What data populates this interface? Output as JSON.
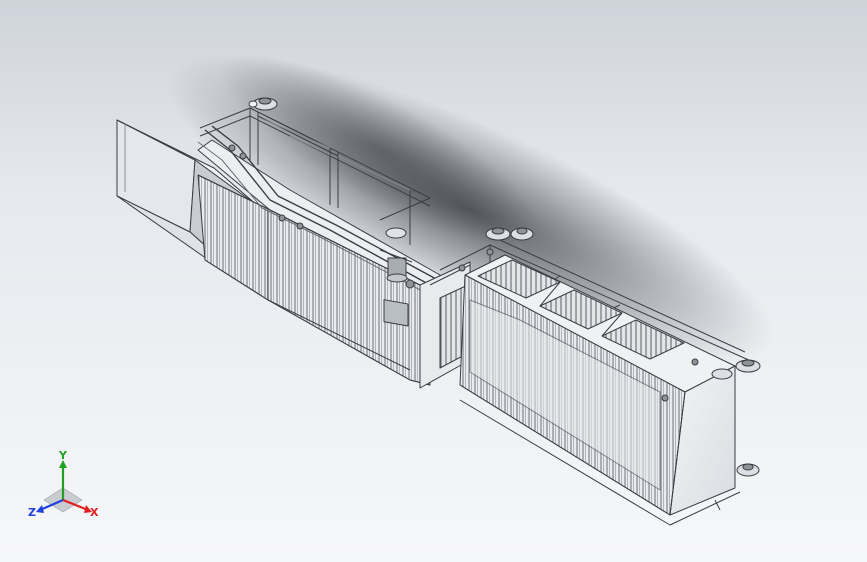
{
  "view": {
    "background_top": "#cfd3da",
    "background_bottom": "#f6f7f9"
  },
  "triad": {
    "x_label": "X",
    "y_label": "Y",
    "z_label": "Z",
    "x_color": "#e02020",
    "y_color": "#20a020",
    "z_color": "#2040e0"
  },
  "model": {
    "name_icon": "screen-conveyor-assembly",
    "line_color": "#3a3d44",
    "face_color": "#eef0f3",
    "shade_color": "#d4d8de"
  }
}
